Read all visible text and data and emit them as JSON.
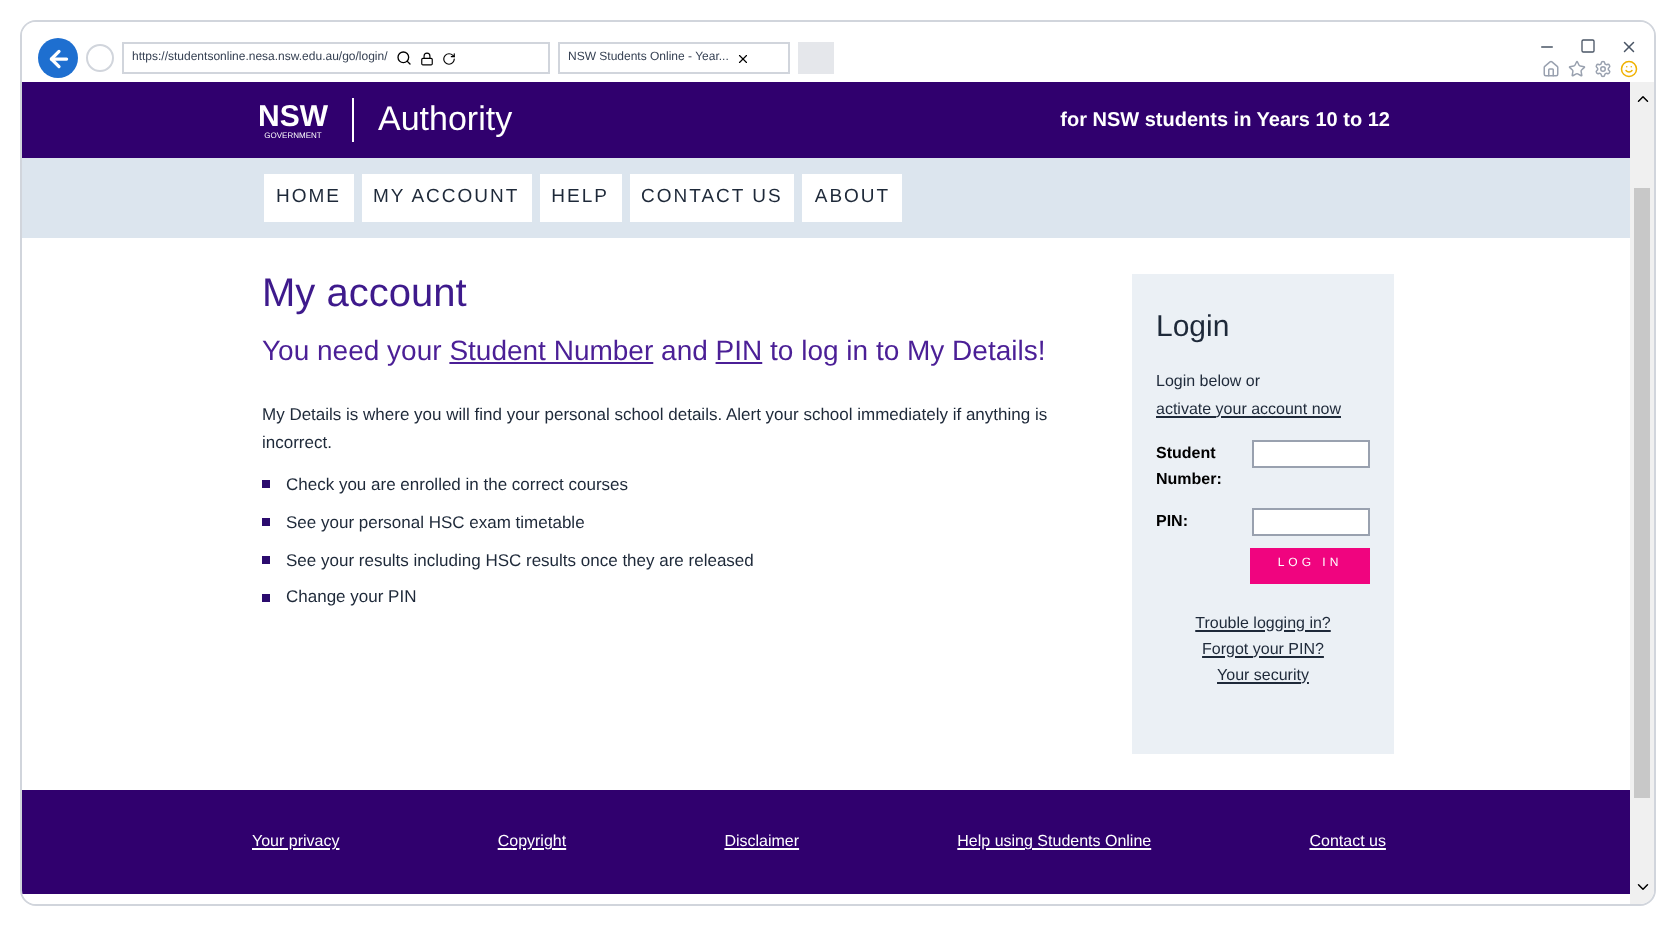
{
  "browser": {
    "address": "https://studentsonline.nesa.nsw.edu.au/go/login/",
    "tab_title": "NSW Students Online - Year..."
  },
  "header": {
    "logo_text": "NSW",
    "logo_subtext": "GOVERNMENT",
    "authority": "Authority",
    "tagline": "for NSW students in Years 10 to 12"
  },
  "nav": [
    "HOME",
    "MY ACCOUNT",
    "HELP",
    "CONTACT US",
    "ABOUT"
  ],
  "main": {
    "title": "My account",
    "subtitle_parts": [
      {
        "text": "You need your ",
        "link": false
      },
      {
        "text": "Student Number",
        "link": true
      },
      {
        "text": " and ",
        "link": false
      },
      {
        "text": "PIN",
        "link": true
      },
      {
        "text": " to log in to My Details!",
        "link": false
      }
    ],
    "intro": "My Details is where you will find your personal school details. Alert your school immediately if anything is incorrect.",
    "bullets": [
      "Check you are enrolled in the correct courses",
      "See your personal HSC exam timetable",
      "See your results including HSC results once they are released",
      "Change your PIN"
    ]
  },
  "login": {
    "title": "Login",
    "intro": "Login below or ",
    "intro_link": "activate your account now",
    "fields": [
      {
        "label": "Student Number:"
      },
      {
        "label": "PIN:"
      }
    ],
    "button": "LOG IN",
    "links": [
      "Trouble logging in?",
      "Forgot your PIN?",
      "Your security"
    ]
  },
  "footer": [
    "Your privacy",
    "Copyright",
    "Disclaimer",
    "Help using Students Online",
    "Contact us"
  ]
}
